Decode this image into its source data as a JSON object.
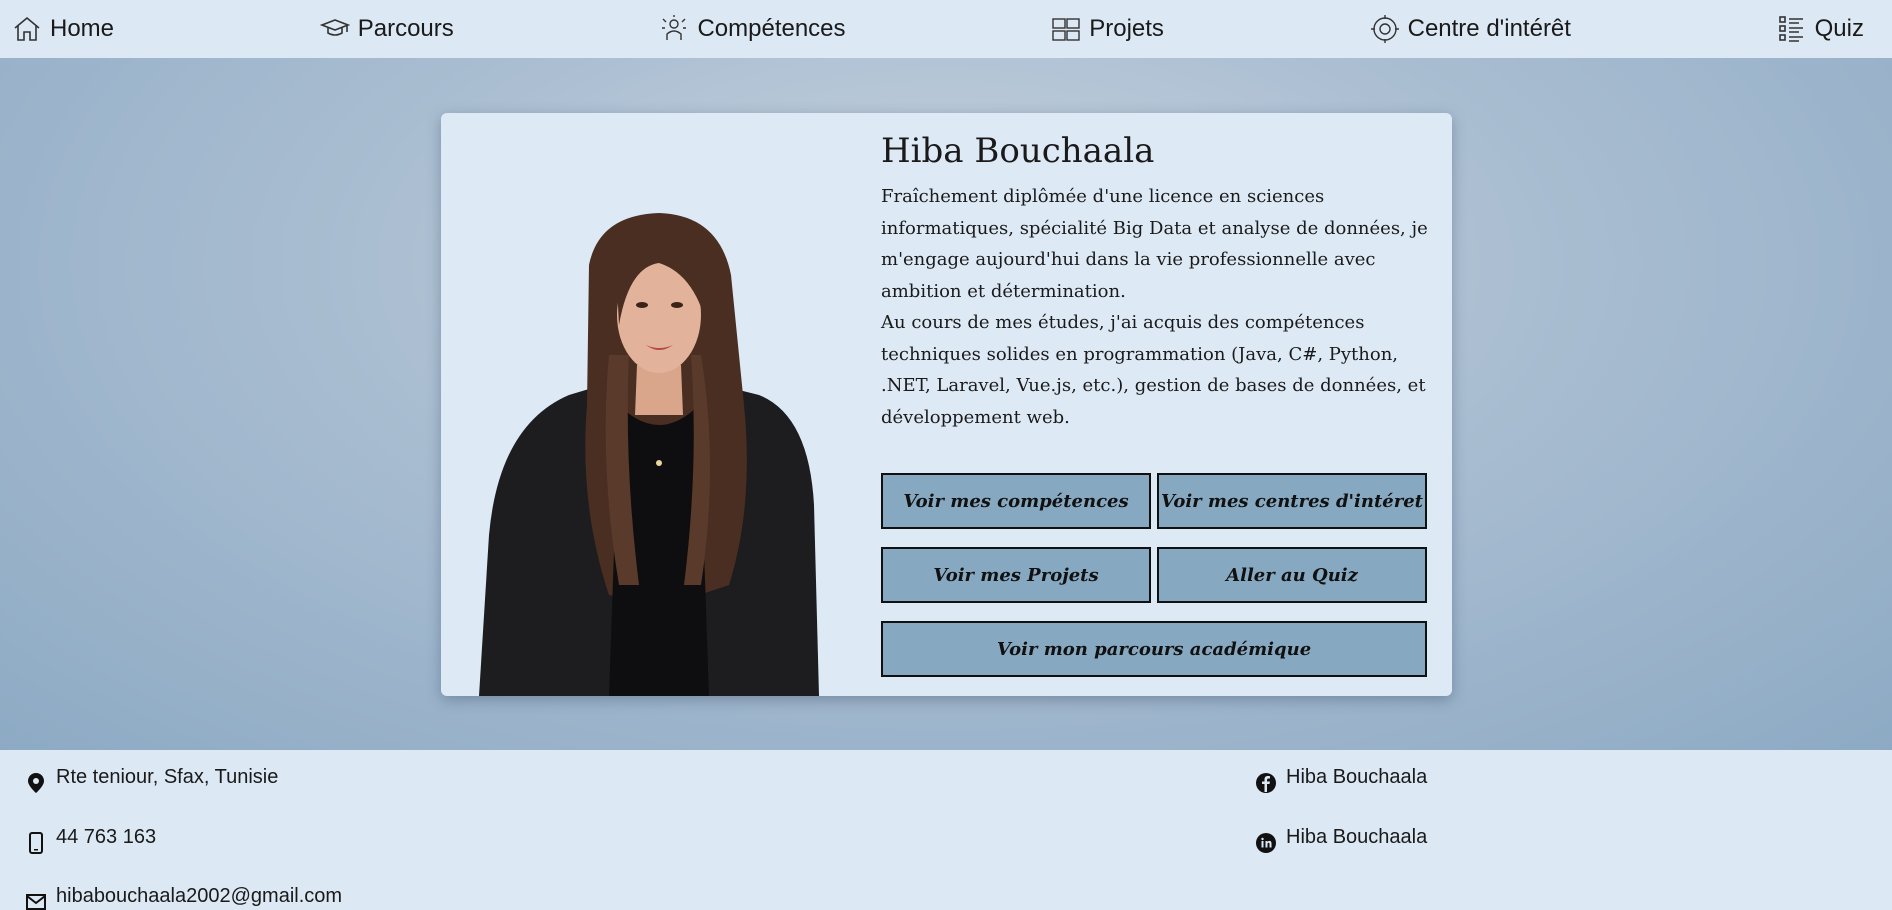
{
  "nav": {
    "items": [
      {
        "label": "Home",
        "icon": "house-icon"
      },
      {
        "label": "Parcours",
        "icon": "graduation-cap-icon"
      },
      {
        "label": "Compétences",
        "icon": "skills-icon"
      },
      {
        "label": "Projets",
        "icon": "projects-icon"
      },
      {
        "label": "Centre d'intérêt",
        "icon": "interests-icon"
      },
      {
        "label": "Quiz",
        "icon": "checklist-icon"
      }
    ]
  },
  "profile": {
    "name": "Hiba Bouchaala",
    "bio_p1": "Fraîchement diplômée d'une licence en sciences informatiques, spécialité Big Data et analyse de données, je m'engage aujourd'hui dans la vie professionnelle avec ambition et détermination.",
    "bio_p2": "Au cours de mes études, j'ai acquis des compétences techniques solides en programmation (Java, C#, Python, .NET, Laravel, Vue.js, etc.), gestion de bases de données, et développement web."
  },
  "buttons": {
    "skills": "Voir mes compétences",
    "interests": "Voir mes centres d'intéret",
    "projects": "Voir mes Projets",
    "quiz": "Aller au Quiz",
    "academic": "Voir mon parcours académique"
  },
  "footer": {
    "address": "Rte teniour, Sfax, Tunisie",
    "phone": "44 763 163",
    "email": "hibabouchaala2002@gmail.com",
    "facebook": "Hiba Bouchaala",
    "linkedin": "Hiba Bouchaala"
  },
  "colors": {
    "nav_bg": "#dce8f4",
    "card_bg": "#dde9f5",
    "button_bg": "#86a8c1",
    "hero_edge": "#8daac4"
  }
}
